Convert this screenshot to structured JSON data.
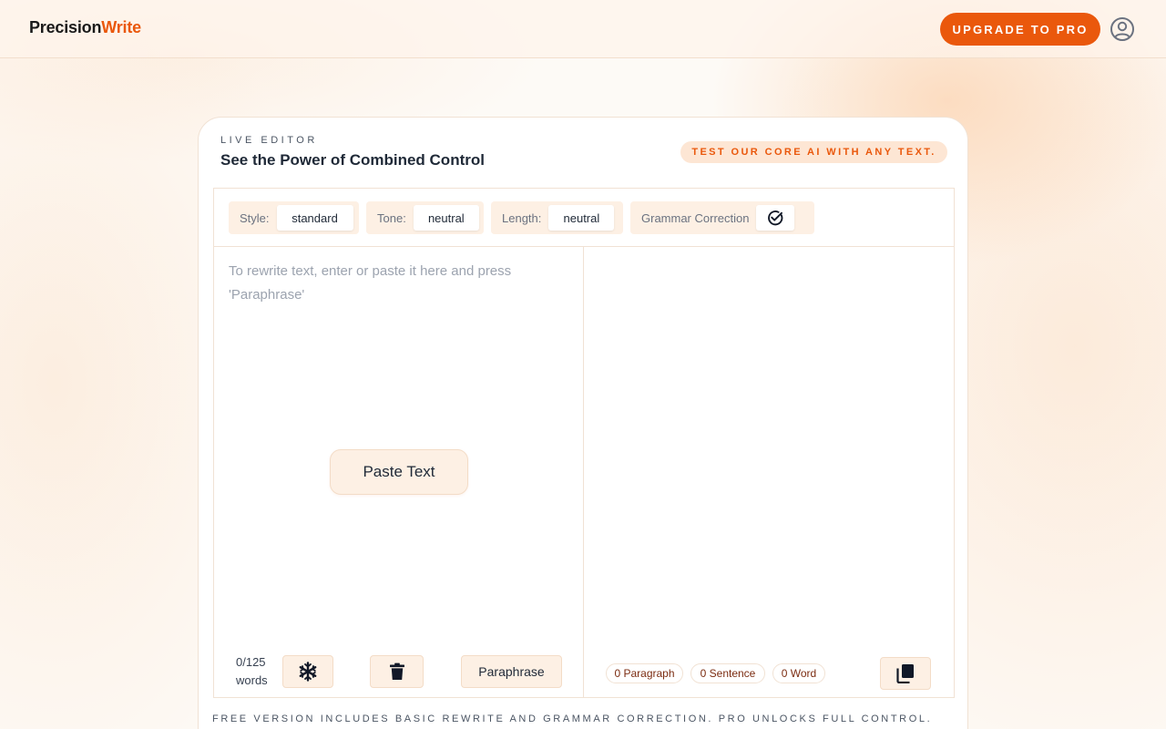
{
  "header": {
    "logo_part1": "Precision",
    "logo_part2": "Write",
    "upgrade_label": "UPGRADE TO PRO",
    "accent_color": "#ea580c"
  },
  "card": {
    "eyebrow": "LIVE EDITOR",
    "title": "See the Power of Combined Control",
    "pill": "TEST OUR CORE AI WITH ANY TEXT."
  },
  "toolbar": {
    "style_label": "Style:",
    "style_value": "standard",
    "tone_label": "Tone:",
    "tone_value": "neutral",
    "length_label": "Length:",
    "length_value": "neutral",
    "grammar_label": "Grammar Correction",
    "grammar_icon": "check-circle-icon"
  },
  "input": {
    "placeholder": "To rewrite text, enter or paste it here and press 'Paraphrase'",
    "value": "",
    "paste_label": "Paste Text",
    "word_count": "0/125 words",
    "freeze_icon": "snowflake-icon",
    "delete_icon": "trash-icon",
    "paraphrase_label": "Paraphrase"
  },
  "output": {
    "paragraph_count": "0 Paragraph",
    "sentence_count": "0 Sentence",
    "word_count": "0 Word",
    "copy_icon": "copy-icon"
  },
  "footnote": "FREE VERSION INCLUDES BASIC REWRITE AND GRAMMAR CORRECTION. PRO UNLOCKS FULL CONTROL."
}
